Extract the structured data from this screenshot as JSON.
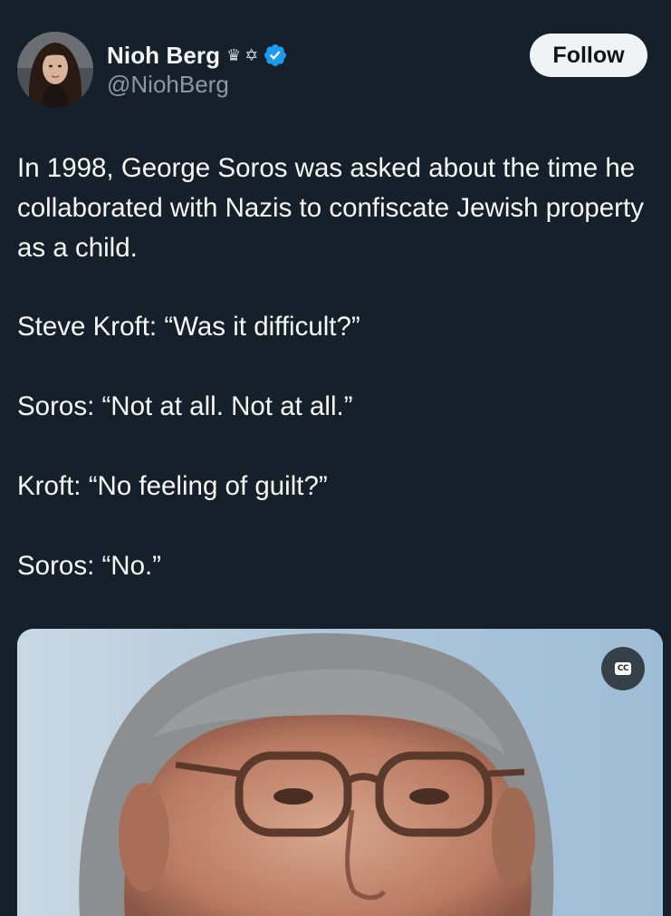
{
  "author": {
    "display_name": "Nioh Berg",
    "emoji_1": "♛",
    "emoji_2": "✡",
    "handle": "@NiohBerg",
    "verified": true,
    "verified_color": "#1d9bf0"
  },
  "actions": {
    "follow_label": "Follow"
  },
  "tweet": {
    "paragraphs": [
      "In 1998, George Soros was asked about the time he collaborated with Nazis to confiscate Jewish property as a child.",
      "Steve Kroft: “Was it difficult?”",
      "Soros: “Not at all. Not at all.”",
      "Kroft: “No feeling of guilt?”",
      "Soros: “No.”"
    ]
  },
  "media": {
    "type": "video",
    "cc_label": "CC",
    "icon": "closed-captions-icon"
  },
  "theme": {
    "background": "#15202b",
    "text": "#f7f9f9",
    "secondary_text": "#8b98a5",
    "follow_bg": "#eff3f4"
  }
}
